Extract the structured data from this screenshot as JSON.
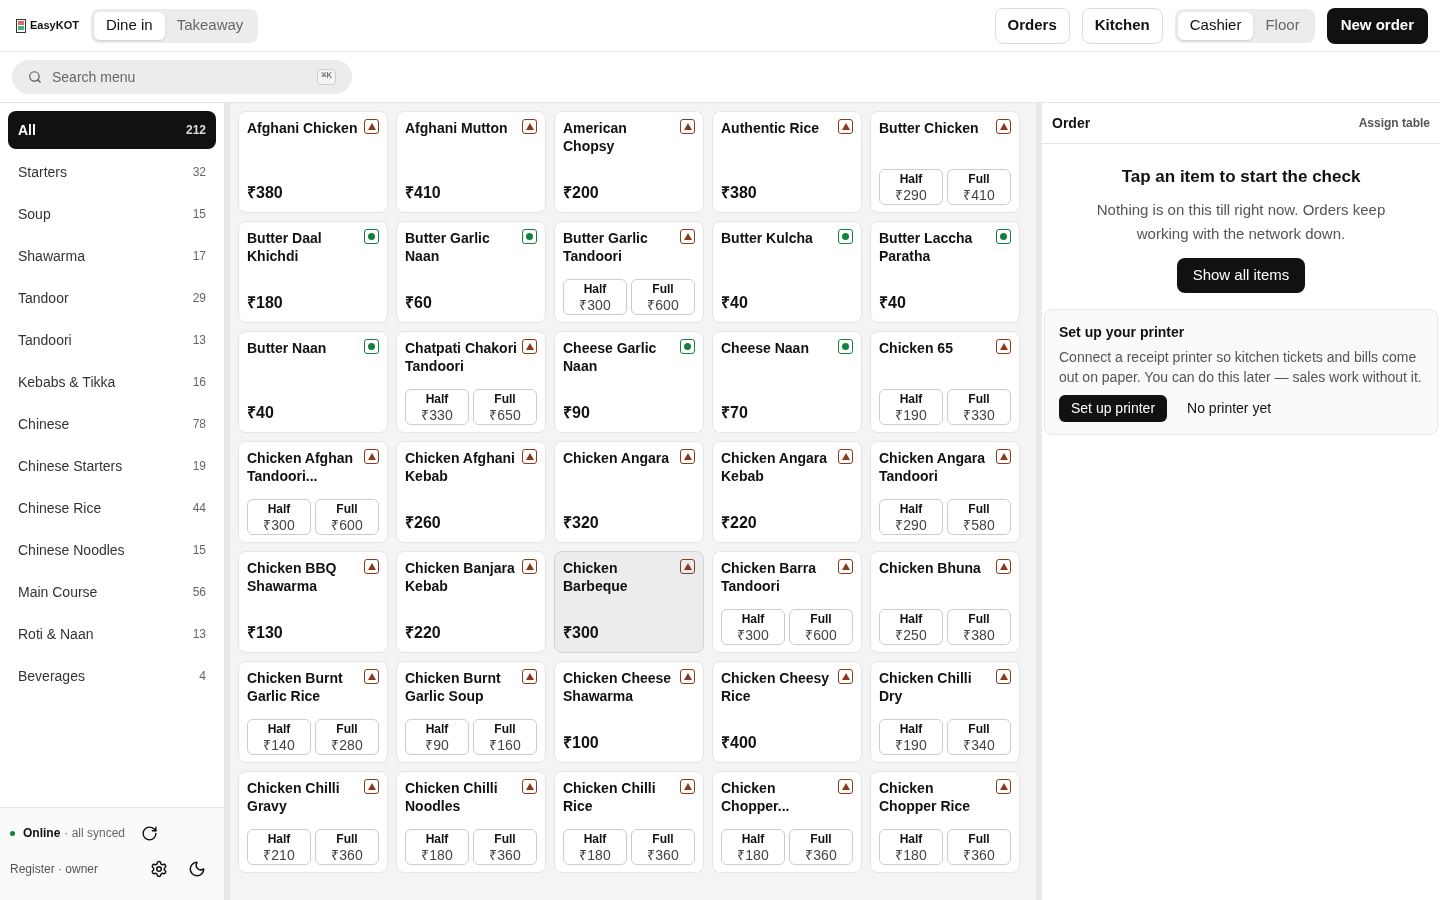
{
  "brand": "EasyKOT",
  "service_tabs": [
    {
      "label": "Dine in",
      "selected": true
    },
    {
      "label": "Takeaway",
      "selected": false
    }
  ],
  "nav_buttons": [
    "Orders",
    "Kitchen"
  ],
  "role_tabs": [
    {
      "label": "Cashier",
      "selected": true
    },
    {
      "label": "Floor",
      "selected": false
    }
  ],
  "new_order": "New order",
  "search": {
    "placeholder": "Search menu",
    "shortcut": "⌘K"
  },
  "categories": [
    {
      "label": "All",
      "count": "212",
      "selected": true
    },
    {
      "label": "Starters",
      "count": "32",
      "selected": false
    },
    {
      "label": "Soup",
      "count": "15",
      "selected": false
    },
    {
      "label": "Shawarma",
      "count": "17",
      "selected": false
    },
    {
      "label": "Tandoor",
      "count": "29",
      "selected": false
    },
    {
      "label": "Tandoori",
      "count": "13",
      "selected": false
    },
    {
      "label": "Kebabs & Tikka",
      "count": "16",
      "selected": false
    },
    {
      "label": "Chinese",
      "count": "78",
      "selected": false
    },
    {
      "label": "Chinese Starters",
      "count": "19",
      "selected": false
    },
    {
      "label": "Chinese Rice",
      "count": "44",
      "selected": false
    },
    {
      "label": "Chinese Noodles",
      "count": "15",
      "selected": false
    },
    {
      "label": "Main Course",
      "count": "56",
      "selected": false
    },
    {
      "label": "Roti & Naan",
      "count": "13",
      "selected": false
    },
    {
      "label": "Beverages",
      "count": "4",
      "selected": false
    }
  ],
  "status": {
    "online": true,
    "label": "Online",
    "detail": "· all synced"
  },
  "register": "Register · owner",
  "items": [
    {
      "name": "Afghani Chicken",
      "kind": "nonveg",
      "selected": false,
      "price": "₹380"
    },
    {
      "name": "Afghani Mutton",
      "kind": "nonveg",
      "selected": false,
      "price": "₹410"
    },
    {
      "name": "American Chopsy",
      "kind": "nonveg",
      "selected": false,
      "price": "₹200"
    },
    {
      "name": "Authentic Rice",
      "kind": "nonveg",
      "selected": false,
      "price": "₹380"
    },
    {
      "name": "Butter Chicken",
      "kind": "nonveg",
      "selected": false,
      "variants": [
        {
          "label": "Half",
          "price": "₹290"
        },
        {
          "label": "Full",
          "price": "₹410"
        }
      ]
    },
    {
      "name": "Butter Daal Khichdi",
      "kind": "veg",
      "selected": false,
      "price": "₹180"
    },
    {
      "name": "Butter Garlic Naan",
      "kind": "veg",
      "selected": false,
      "price": "₹60"
    },
    {
      "name": "Butter Garlic Tandoori",
      "kind": "nonveg",
      "selected": false,
      "variants": [
        {
          "label": "Half",
          "price": "₹300"
        },
        {
          "label": "Full",
          "price": "₹600"
        }
      ]
    },
    {
      "name": "Butter Kulcha",
      "kind": "veg",
      "selected": false,
      "price": "₹40"
    },
    {
      "name": "Butter Laccha Paratha",
      "kind": "veg",
      "selected": false,
      "price": "₹40"
    },
    {
      "name": "Butter Naan",
      "kind": "veg",
      "selected": false,
      "price": "₹40"
    },
    {
      "name": "Chatpati Chakori Tandoori",
      "kind": "nonveg",
      "selected": false,
      "variants": [
        {
          "label": "Half",
          "price": "₹330"
        },
        {
          "label": "Full",
          "price": "₹650"
        }
      ]
    },
    {
      "name": "Cheese Garlic Naan",
      "kind": "veg",
      "selected": false,
      "price": "₹90"
    },
    {
      "name": "Cheese Naan",
      "kind": "veg",
      "selected": false,
      "price": "₹70"
    },
    {
      "name": "Chicken 65",
      "kind": "nonveg",
      "selected": false,
      "variants": [
        {
          "label": "Half",
          "price": "₹190"
        },
        {
          "label": "Full",
          "price": "₹330"
        }
      ]
    },
    {
      "name": "Chicken Afghan Tandoori...",
      "kind": "nonveg",
      "selected": false,
      "variants": [
        {
          "label": "Half",
          "price": "₹300"
        },
        {
          "label": "Full",
          "price": "₹600"
        }
      ]
    },
    {
      "name": "Chicken Afghani Kebab",
      "kind": "nonveg",
      "selected": false,
      "price": "₹260"
    },
    {
      "name": "Chicken Angara",
      "kind": "nonveg",
      "selected": false,
      "price": "₹320"
    },
    {
      "name": "Chicken Angara Kebab",
      "kind": "nonveg",
      "selected": false,
      "price": "₹220"
    },
    {
      "name": "Chicken Angara Tandoori",
      "kind": "nonveg",
      "selected": false,
      "variants": [
        {
          "label": "Half",
          "price": "₹290"
        },
        {
          "label": "Full",
          "price": "₹580"
        }
      ]
    },
    {
      "name": "Chicken BBQ Shawarma",
      "kind": "nonveg",
      "selected": false,
      "price": "₹130"
    },
    {
      "name": "Chicken Banjara Kebab",
      "kind": "nonveg",
      "selected": false,
      "price": "₹220"
    },
    {
      "name": "Chicken Barbeque",
      "kind": "nonveg",
      "selected": true,
      "price": "₹300"
    },
    {
      "name": "Chicken Barra Tandoori",
      "kind": "nonveg",
      "selected": false,
      "variants": [
        {
          "label": "Half",
          "price": "₹300"
        },
        {
          "label": "Full",
          "price": "₹600"
        }
      ]
    },
    {
      "name": "Chicken Bhuna",
      "kind": "nonveg",
      "selected": false,
      "variants": [
        {
          "label": "Half",
          "price": "₹250"
        },
        {
          "label": "Full",
          "price": "₹380"
        }
      ]
    },
    {
      "name": "Chicken Burnt Garlic Rice",
      "kind": "nonveg",
      "selected": false,
      "variants": [
        {
          "label": "Half",
          "price": "₹140"
        },
        {
          "label": "Full",
          "price": "₹280"
        }
      ]
    },
    {
      "name": "Chicken Burnt Garlic Soup",
      "kind": "nonveg",
      "selected": false,
      "variants": [
        {
          "label": "Half",
          "price": "₹90"
        },
        {
          "label": "Full",
          "price": "₹160"
        }
      ]
    },
    {
      "name": "Chicken Cheese Shawarma",
      "kind": "nonveg",
      "selected": false,
      "price": "₹100"
    },
    {
      "name": "Chicken Cheesy Rice",
      "kind": "nonveg",
      "selected": false,
      "price": "₹400"
    },
    {
      "name": "Chicken Chilli Dry",
      "kind": "nonveg",
      "selected": false,
      "variants": [
        {
          "label": "Half",
          "price": "₹190"
        },
        {
          "label": "Full",
          "price": "₹340"
        }
      ]
    },
    {
      "name": "Chicken Chilli Gravy",
      "kind": "nonveg",
      "selected": false,
      "variants": [
        {
          "label": "Half",
          "price": "₹210"
        },
        {
          "label": "Full",
          "price": "₹360"
        }
      ]
    },
    {
      "name": "Chicken Chilli Noodles",
      "kind": "nonveg",
      "selected": false,
      "variants": [
        {
          "label": "Half",
          "price": "₹180"
        },
        {
          "label": "Full",
          "price": "₹360"
        }
      ]
    },
    {
      "name": "Chicken Chilli Rice",
      "kind": "nonveg",
      "selected": false,
      "variants": [
        {
          "label": "Half",
          "price": "₹180"
        },
        {
          "label": "Full",
          "price": "₹360"
        }
      ]
    },
    {
      "name": "Chicken Chopper...",
      "kind": "nonveg",
      "selected": false,
      "variants": [
        {
          "label": "Half",
          "price": "₹180"
        },
        {
          "label": "Full",
          "price": "₹360"
        }
      ]
    },
    {
      "name": "Chicken Chopper Rice",
      "kind": "nonveg",
      "selected": false,
      "variants": [
        {
          "label": "Half",
          "price": "₹180"
        },
        {
          "label": "Full",
          "price": "₹360"
        }
      ]
    }
  ],
  "order": {
    "title": "Order",
    "assign": "Assign table",
    "empty_title": "Tap an item to start the check",
    "empty_text": "Nothing is on this till right now. Orders keep working with the network down.",
    "show_all": "Show all items"
  },
  "printer": {
    "title": "Set up your printer",
    "text": "Connect a receipt printer so kitchen tickets and bills come out on paper. You can do this later — sales work without it.",
    "primary": "Set up printer",
    "secondary": "No printer yet"
  }
}
